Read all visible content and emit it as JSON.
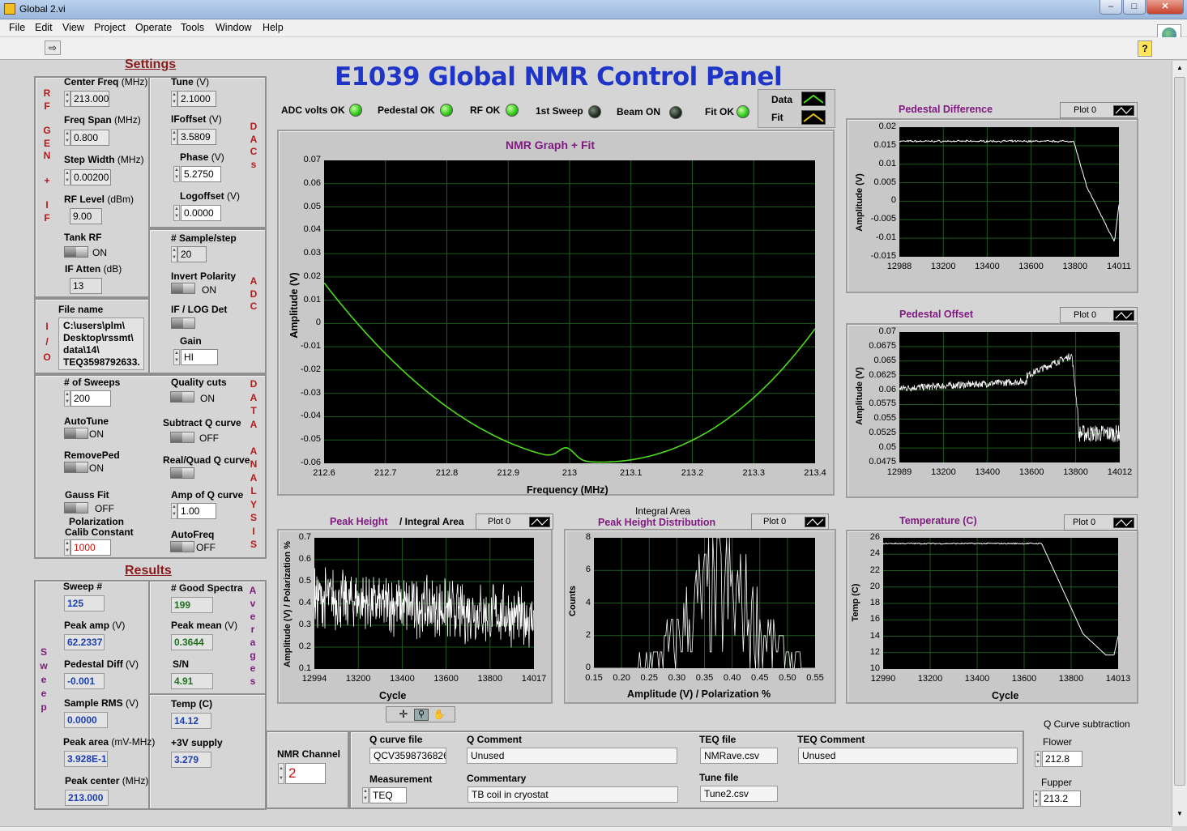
{
  "window": {
    "title": "Global 2.vi"
  },
  "menu": [
    "File",
    "Edit",
    "View",
    "Project",
    "Operate",
    "Tools",
    "Window",
    "Help"
  ],
  "panel_title": "E1039 Global NMR Control Panel",
  "settings": {
    "heading": "Settings",
    "rf_gen_if_letters": [
      "R",
      "F",
      "",
      "G",
      "E",
      "N",
      "",
      "+",
      "",
      "I",
      "F"
    ],
    "center_freq": {
      "label": "Center Freq",
      "unit": "(MHz)",
      "value": "213.000"
    },
    "freq_span": {
      "label": "Freq Span",
      "unit": "(MHz)",
      "value": "0.800"
    },
    "step_width": {
      "label": "Step Width",
      "unit": "(MHz)",
      "value": "0.00200"
    },
    "rf_level": {
      "label": "RF Level",
      "unit": "(dBm)",
      "value": "9.00"
    },
    "tank_rf": {
      "label": "Tank RF",
      "state": "ON"
    },
    "if_atten": {
      "label": "IF Atten",
      "unit": "(dB)",
      "value": "13"
    },
    "tune": {
      "label": "Tune",
      "unit": "(V)",
      "value": "2.1000"
    },
    "ioffset": {
      "label": "IFoffset",
      "unit": "(V)",
      "value": "3.5809"
    },
    "phase": {
      "label": "Phase",
      "unit": "(V)",
      "value": "5.2750"
    },
    "logoffset": {
      "label": "Logoffset",
      "unit": "(V)",
      "value": "0.0000"
    },
    "dacs_letters": [
      "D",
      "A",
      "C",
      "s"
    ],
    "sample_step": {
      "label": "# Sample/step",
      "value": "20"
    },
    "invert_polarity": {
      "label": "Invert Polarity",
      "state": "ON"
    },
    "if_log_det": {
      "label": "IF / LOG Det"
    },
    "gain": {
      "label": "Gain",
      "value": "HI"
    },
    "adc_letters": [
      "A",
      "D",
      "C"
    ],
    "file_name": {
      "label": "File name",
      "value": "C:\\users\\plm\\ Desktop\\rssmt\\ data\\14\\ TEQ3598792633."
    },
    "io_letters": [
      "I",
      "/",
      "O"
    ],
    "num_sweeps": {
      "label": "# of Sweeps",
      "value": "200"
    },
    "quality_cuts": {
      "label": "Quality cuts",
      "state": "ON"
    },
    "autotune": {
      "label": "AutoTune",
      "state": "ON"
    },
    "subtract_q": {
      "label": "Subtract Q curve",
      "state": "OFF"
    },
    "removeped": {
      "label": "RemovePed",
      "state": "ON"
    },
    "real_quad": {
      "label": "Real/Quad Q curve"
    },
    "gauss_fit": {
      "label": "Gauss Fit",
      "state": "OFF"
    },
    "amp_q": {
      "label": "Amp of Q curve",
      "value": "1.00"
    },
    "pol_calib": {
      "label1": "Polarization",
      "label2": "Calib Constant",
      "value": "1000"
    },
    "autofreq": {
      "label": "AutoFreq",
      "state": "OFF"
    },
    "data_analysis_letters": [
      "D",
      "A",
      "T",
      "A",
      "",
      "A",
      "N",
      "A",
      "L",
      "Y",
      "S",
      "I",
      "S"
    ]
  },
  "results": {
    "heading": "Results",
    "sweep_letters": [
      "S",
      "w",
      "e",
      "e",
      "p"
    ],
    "averages_letters": [
      "A",
      "v",
      "e",
      "r",
      "a",
      "g",
      "e",
      "s"
    ],
    "sweep_num": {
      "label": "Sweep #",
      "value": "125"
    },
    "peak_amp": {
      "label": "Peak amp",
      "unit": "(V)",
      "value": "62.2337"
    },
    "pedestal_diff": {
      "label": "Pedestal Diff",
      "unit": "(V)",
      "value": "-0.001"
    },
    "sample_rms": {
      "label": "Sample RMS",
      "unit": "(V)",
      "value": "0.0000"
    },
    "peak_area": {
      "label": "Peak area",
      "unit": "(mV-MHz)",
      "value": "3.928E-1"
    },
    "peak_center": {
      "label": "Peak center",
      "unit": "(MHz)",
      "value": "213.000"
    },
    "good_spectra": {
      "label": "# Good Spectra",
      "value": "199"
    },
    "peak_mean": {
      "label": "Peak mean",
      "unit": "(V)",
      "value": "0.3644"
    },
    "sn": {
      "label": "S/N",
      "value": "4.91"
    },
    "temp": {
      "label": "Temp (C)",
      "value": "14.12"
    },
    "supply": {
      "label": "+3V supply",
      "value": "3.279"
    }
  },
  "status_leds": [
    {
      "label": "ADC volts OK",
      "on": true
    },
    {
      "label": "Pedestal OK",
      "on": true
    },
    {
      "label": "RF OK",
      "on": true
    },
    {
      "label": "1st Sweep",
      "on": false
    },
    {
      "label": "Beam ON",
      "on": false
    },
    {
      "label": "Fit OK",
      "on": true
    }
  ],
  "legend": {
    "data": "Data",
    "fit": "Fit",
    "data_color": "#4cdc1c",
    "fit_color": "#e8c020"
  },
  "plot_label": "Plot 0",
  "nmr_graph": {
    "title": "NMR Graph + Fit",
    "xlabel": "Frequency (MHz)",
    "ylabel": "Amplitude (V)",
    "xticks": [
      "212.6",
      "212.7",
      "212.8",
      "212.9",
      "213",
      "213.1",
      "213.2",
      "213.3",
      "213.4"
    ],
    "yticks": [
      "0.07",
      "0.06",
      "0.05",
      "0.04",
      "0.03",
      "0.02",
      "0.01",
      "0",
      "-0.01",
      "-0.02",
      "-0.03",
      "-0.04",
      "-0.05",
      "-0.06"
    ]
  },
  "ped_diff": {
    "title": "Pedestal Difference",
    "ylabel": "Amplitude (V)",
    "xticks": [
      "12988",
      "13200",
      "13400",
      "13600",
      "13800",
      "14011"
    ],
    "yticks": [
      "0.02",
      "0.015",
      "0.01",
      "0.005",
      "0",
      "-0.005",
      "-0.01",
      "-0.015"
    ]
  },
  "ped_offset": {
    "title": "Pedestal Offset",
    "ylabel": "Amplitude (V)",
    "xticks": [
      "12989",
      "13200",
      "13400",
      "13600",
      "13800",
      "14012"
    ],
    "yticks": [
      "0.07",
      "0.0675",
      "0.065",
      "0.0625",
      "0.06",
      "0.0575",
      "0.055",
      "0.0525",
      "0.05",
      "0.0475"
    ]
  },
  "peak_height": {
    "title": "Peak Height",
    "title2": "/ Integral Area",
    "xlabel": "Cycle",
    "ylabel": "Amplitude (V) / Polarization %",
    "xticks": [
      "12994",
      "13200",
      "13400",
      "13600",
      "13800",
      "14017"
    ],
    "yticks": [
      "0.7",
      "0.6",
      "0.5",
      "0.4",
      "0.3",
      "0.2",
      "0.1"
    ]
  },
  "peak_dist": {
    "title_top": "Integral Area",
    "title": "Peak Height Distribution",
    "xlabel": "Amplitude (V) / Polarization %",
    "ylabel": "Counts",
    "xticks": [
      "0.15",
      "0.20",
      "0.25",
      "0.30",
      "0.35",
      "0.40",
      "0.45",
      "0.50",
      "0.55"
    ],
    "yticks": [
      "8",
      "6",
      "4",
      "2",
      "0"
    ]
  },
  "temperature": {
    "title": "Temperature (C)",
    "xlabel": "Cycle",
    "ylabel": "Temp (C)",
    "xticks": [
      "12990",
      "13200",
      "13400",
      "13600",
      "13800",
      "14013"
    ],
    "yticks": [
      "26",
      "24",
      "22",
      "20",
      "18",
      "16",
      "14",
      "12",
      "10"
    ]
  },
  "bottom": {
    "nmr_channel": {
      "label": "NMR Channel",
      "value": "2"
    },
    "q_curve_file": {
      "label": "Q curve file",
      "value": "QCV3598736826."
    },
    "q_comment": {
      "label": "Q Comment",
      "value": "Unused"
    },
    "teq_file": {
      "label": "TEQ file",
      "value": "NMRave.csv"
    },
    "teq_comment": {
      "label": "TEQ Comment",
      "value": "Unused"
    },
    "measurement": {
      "label": "Measurement",
      "value": "TEQ"
    },
    "commentary": {
      "label": "Commentary",
      "value": "TB coil in cryostat"
    },
    "tune_file": {
      "label": "Tune file",
      "value": "Tune2.csv"
    },
    "q_sub": {
      "label": "Q Curve subtraction",
      "flower_label": "Flower",
      "flower": "212.8",
      "fupper_label": "Fupper",
      "fupper": "213.2"
    }
  }
}
